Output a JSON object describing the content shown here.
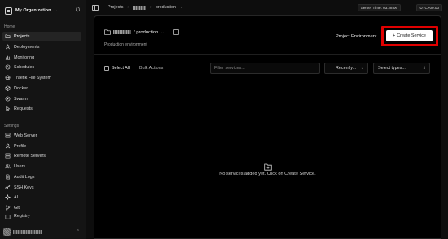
{
  "sidebar": {
    "org_name": "My Organization",
    "home_label": "Home",
    "home_items": [
      {
        "label": "Projects",
        "icon": "folder-icon",
        "active": true
      },
      {
        "label": "Deployments",
        "icon": "rocket-icon"
      },
      {
        "label": "Monitoring",
        "icon": "chart-icon"
      },
      {
        "label": "Schedules",
        "icon": "clock-icon"
      },
      {
        "label": "Traefik File System",
        "icon": "globe-icon"
      },
      {
        "label": "Docker",
        "icon": "box-icon"
      },
      {
        "label": "Swarm",
        "icon": "swarm-icon"
      },
      {
        "label": "Requests",
        "icon": "pointer-icon"
      }
    ],
    "settings_label": "Settings",
    "settings_items": [
      {
        "label": "Web Server",
        "icon": "server-icon"
      },
      {
        "label": "Profile",
        "icon": "user-icon"
      },
      {
        "label": "Remote Servers",
        "icon": "server-icon"
      },
      {
        "label": "Users",
        "icon": "users-icon"
      },
      {
        "label": "Audit Logs",
        "icon": "file-icon"
      },
      {
        "label": "SSH Keys",
        "icon": "key-icon"
      },
      {
        "label": "AI",
        "icon": "bot-icon"
      },
      {
        "label": "Git",
        "icon": "git-icon"
      },
      {
        "label": "Registry",
        "icon": "package-icon"
      }
    ]
  },
  "topbar": {
    "crumb_projects": "Projects",
    "crumb_env": "production",
    "server_time": "Server Time: 03:28:06",
    "timezone": "UTC+00:00"
  },
  "project": {
    "env_name": "/ production",
    "description": "Production environment",
    "env_label": "Project Environment",
    "create_button": "Create Service"
  },
  "toolbar": {
    "select_all": "Select All",
    "bulk_actions": "Bulk Actions",
    "filter_placeholder": "Filter services...",
    "sort_value": "Recently...",
    "type_value": "Select types..."
  },
  "empty_state": {
    "message": "No services added yet. Click on Create Service."
  },
  "colors": {
    "highlight": "#e00000",
    "background": "#000000",
    "sidebar": "#141414"
  }
}
